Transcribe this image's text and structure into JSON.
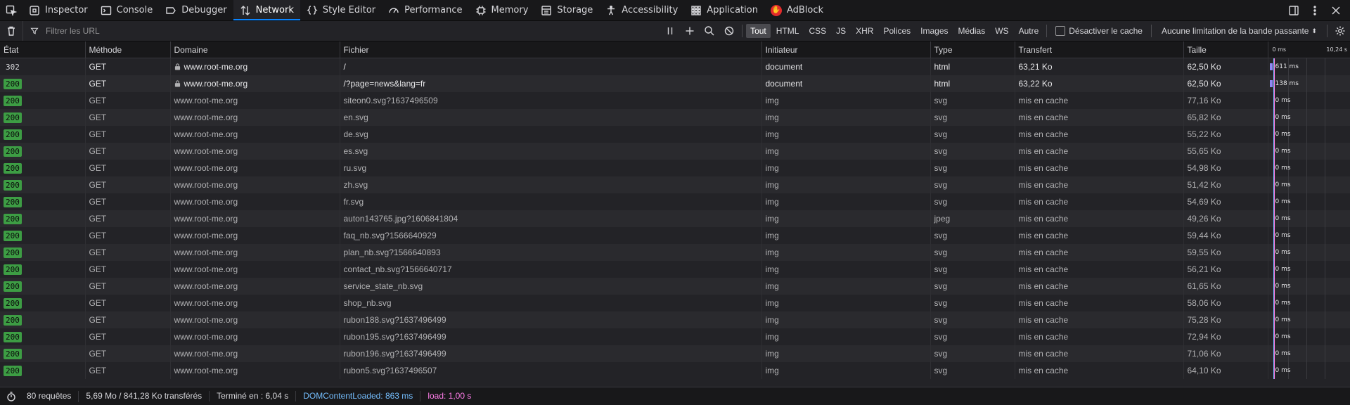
{
  "toolbar": {
    "tabs": [
      {
        "label": "Inspector",
        "icon": "inspector-icon"
      },
      {
        "label": "Console",
        "icon": "console-icon"
      },
      {
        "label": "Debugger",
        "icon": "debugger-icon"
      },
      {
        "label": "Network",
        "icon": "network-icon",
        "active": true
      },
      {
        "label": "Style Editor",
        "icon": "style-editor-icon"
      },
      {
        "label": "Performance",
        "icon": "performance-icon"
      },
      {
        "label": "Memory",
        "icon": "memory-icon"
      },
      {
        "label": "Storage",
        "icon": "storage-icon"
      },
      {
        "label": "Accessibility",
        "icon": "accessibility-icon"
      },
      {
        "label": "Application",
        "icon": "application-icon"
      },
      {
        "label": "AdBlock",
        "icon": "adblock-icon"
      }
    ]
  },
  "filter": {
    "placeholder": "Filtrer les URL",
    "types": [
      "Tout",
      "HTML",
      "CSS",
      "JS",
      "XHR",
      "Polices",
      "Images",
      "Médias",
      "WS",
      "Autre"
    ],
    "active_type": "Tout",
    "disable_cache_label": "Désactiver le cache",
    "throttle_label": "Aucune limitation de la bande passante"
  },
  "columns": {
    "status": "État",
    "method": "Méthode",
    "domain": "Domaine",
    "file": "Fichier",
    "initiator": "Initiateur",
    "type": "Type",
    "transfer": "Transfert",
    "size": "Taille",
    "wf_tick_start": "0 ms",
    "wf_tick_end": "10,24 s"
  },
  "requests": [
    {
      "status": "302",
      "method": "GET",
      "secure": true,
      "domain": "www.root-me.org",
      "file": "/",
      "initiator": "document",
      "type": "html",
      "transfer": "63,21 Ko",
      "size": "62,50 Ko",
      "timing": "611 ms"
    },
    {
      "status": "200",
      "method": "GET",
      "secure": true,
      "domain": "www.root-me.org",
      "file": "/?page=news&lang=fr",
      "initiator": "document",
      "type": "html",
      "transfer": "63,22 Ko",
      "size": "62,50 Ko",
      "timing": "138 ms"
    },
    {
      "status": "200",
      "method": "GET",
      "domain": "www.root-me.org",
      "file": "siteon0.svg?1637496509",
      "initiator": "img",
      "type": "svg",
      "transfer": "mis en cache",
      "size": "77,16 Ko",
      "timing": "0 ms"
    },
    {
      "status": "200",
      "method": "GET",
      "domain": "www.root-me.org",
      "file": "en.svg",
      "initiator": "img",
      "type": "svg",
      "transfer": "mis en cache",
      "size": "65,82 Ko",
      "timing": "0 ms"
    },
    {
      "status": "200",
      "method": "GET",
      "domain": "www.root-me.org",
      "file": "de.svg",
      "initiator": "img",
      "type": "svg",
      "transfer": "mis en cache",
      "size": "55,22 Ko",
      "timing": "0 ms"
    },
    {
      "status": "200",
      "method": "GET",
      "domain": "www.root-me.org",
      "file": "es.svg",
      "initiator": "img",
      "type": "svg",
      "transfer": "mis en cache",
      "size": "55,65 Ko",
      "timing": "0 ms"
    },
    {
      "status": "200",
      "method": "GET",
      "domain": "www.root-me.org",
      "file": "ru.svg",
      "initiator": "img",
      "type": "svg",
      "transfer": "mis en cache",
      "size": "54,98 Ko",
      "timing": "0 ms"
    },
    {
      "status": "200",
      "method": "GET",
      "domain": "www.root-me.org",
      "file": "zh.svg",
      "initiator": "img",
      "type": "svg",
      "transfer": "mis en cache",
      "size": "51,42 Ko",
      "timing": "0 ms"
    },
    {
      "status": "200",
      "method": "GET",
      "domain": "www.root-me.org",
      "file": "fr.svg",
      "initiator": "img",
      "type": "svg",
      "transfer": "mis en cache",
      "size": "54,69 Ko",
      "timing": "0 ms"
    },
    {
      "status": "200",
      "method": "GET",
      "domain": "www.root-me.org",
      "file": "auton143765.jpg?1606841804",
      "initiator": "img",
      "type": "jpeg",
      "transfer": "mis en cache",
      "size": "49,26 Ko",
      "timing": "0 ms"
    },
    {
      "status": "200",
      "method": "GET",
      "domain": "www.root-me.org",
      "file": "faq_nb.svg?1566640929",
      "initiator": "img",
      "type": "svg",
      "transfer": "mis en cache",
      "size": "59,44 Ko",
      "timing": "0 ms"
    },
    {
      "status": "200",
      "method": "GET",
      "domain": "www.root-me.org",
      "file": "plan_nb.svg?1566640893",
      "initiator": "img",
      "type": "svg",
      "transfer": "mis en cache",
      "size": "59,55 Ko",
      "timing": "0 ms"
    },
    {
      "status": "200",
      "method": "GET",
      "domain": "www.root-me.org",
      "file": "contact_nb.svg?1566640717",
      "initiator": "img",
      "type": "svg",
      "transfer": "mis en cache",
      "size": "56,21 Ko",
      "timing": "0 ms"
    },
    {
      "status": "200",
      "method": "GET",
      "domain": "www.root-me.org",
      "file": "service_state_nb.svg",
      "initiator": "img",
      "type": "svg",
      "transfer": "mis en cache",
      "size": "61,65 Ko",
      "timing": "0 ms"
    },
    {
      "status": "200",
      "method": "GET",
      "domain": "www.root-me.org",
      "file": "shop_nb.svg",
      "initiator": "img",
      "type": "svg",
      "transfer": "mis en cache",
      "size": "58,06 Ko",
      "timing": "0 ms"
    },
    {
      "status": "200",
      "method": "GET",
      "domain": "www.root-me.org",
      "file": "rubon188.svg?1637496499",
      "initiator": "img",
      "type": "svg",
      "transfer": "mis en cache",
      "size": "75,28 Ko",
      "timing": "0 ms"
    },
    {
      "status": "200",
      "method": "GET",
      "domain": "www.root-me.org",
      "file": "rubon195.svg?1637496499",
      "initiator": "img",
      "type": "svg",
      "transfer": "mis en cache",
      "size": "72,94 Ko",
      "timing": "0 ms"
    },
    {
      "status": "200",
      "method": "GET",
      "domain": "www.root-me.org",
      "file": "rubon196.svg?1637496499",
      "initiator": "img",
      "type": "svg",
      "transfer": "mis en cache",
      "size": "71,06 Ko",
      "timing": "0 ms"
    },
    {
      "status": "200",
      "method": "GET",
      "domain": "www.root-me.org",
      "file": "rubon5.svg?1637496507",
      "initiator": "img",
      "type": "svg",
      "transfer": "mis en cache",
      "size": "64,10 Ko",
      "timing": "0 ms"
    }
  ],
  "summary": {
    "requests": "80 requêtes",
    "transferred": "5,69 Mo / 841,28 Ko transférés",
    "finished": "Terminé en : 6,04 s",
    "dom_content_loaded": "DOMContentLoaded: 863 ms",
    "load": "load: 1,00 s"
  },
  "colors": {
    "accent": "#0a84ff",
    "status_ok": "#3d9d44",
    "waterfall_bar": "#8f87f6",
    "dcl_line": "#75bfff",
    "load_line": "#ff7de9"
  }
}
